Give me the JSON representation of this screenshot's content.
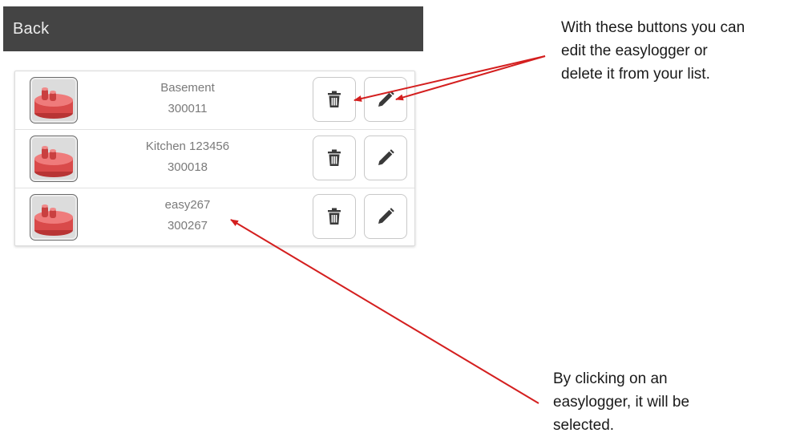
{
  "header": {
    "back_label": "Back"
  },
  "loggers": [
    {
      "name": "Basement",
      "serial": "300011"
    },
    {
      "name": "Kitchen 123456",
      "serial": "300018"
    },
    {
      "name": "easy267",
      "serial": "300267"
    }
  ],
  "annotations": {
    "buttons_note": [
      "With these buttons you can",
      "edit the easylogger or",
      "delete it from your list."
    ],
    "select_note": [
      "By clicking on an",
      "easylogger, it will be",
      "selected."
    ]
  },
  "icons": {
    "delete": "trash-icon",
    "edit": "pencil-icon",
    "logger": "easylogger-device-icon"
  },
  "colors": {
    "header_bg": "#444444",
    "arrow": "#d41f1f",
    "device": "#e85a5a"
  }
}
